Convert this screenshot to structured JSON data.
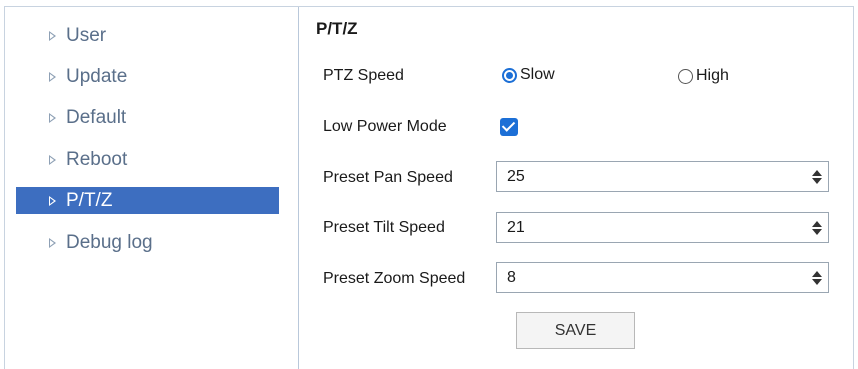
{
  "sidebar": {
    "items": [
      {
        "label": "User"
      },
      {
        "label": "Update"
      },
      {
        "label": "Default"
      },
      {
        "label": "Reboot"
      },
      {
        "label": "P/T/Z",
        "active": true
      },
      {
        "label": "Debug log"
      }
    ]
  },
  "panel": {
    "title": "P/T/Z",
    "ptz_speed": {
      "label": "PTZ Speed",
      "options": [
        "Slow",
        "High"
      ],
      "selected": "Slow"
    },
    "low_power_mode": {
      "label": "Low Power Mode",
      "checked": true
    },
    "preset_pan_speed": {
      "label": "Preset Pan Speed",
      "value": "25"
    },
    "preset_tilt_speed": {
      "label": "Preset Tilt Speed",
      "value": "21"
    },
    "preset_zoom_speed": {
      "label": "Preset Zoom Speed",
      "value": "8"
    },
    "save_label": "SAVE"
  },
  "colors": {
    "active_nav_bg": "#3d6ec0",
    "accent": "#1c6fd6",
    "nav_text": "#5a6f8a",
    "border": "#b9c8da"
  }
}
